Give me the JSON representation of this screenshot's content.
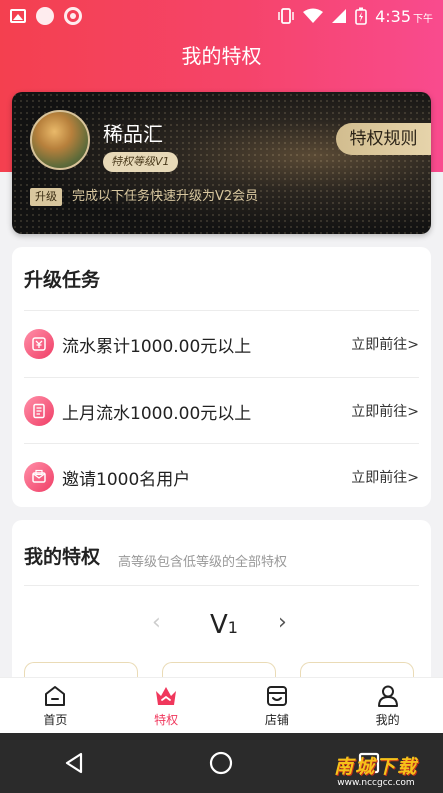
{
  "status_bar": {
    "time": "4:35",
    "ampm": "下午"
  },
  "header": {
    "title": "我的特权"
  },
  "vip_card": {
    "user_name": "稀品汇",
    "level_badge": "特权等级V1",
    "rules_button": "特权规则",
    "upgrade_tag": "升级",
    "upgrade_hint": "完成以下任务快速升级为V2会员"
  },
  "upgrade_tasks": {
    "title": "升级任务",
    "items": [
      {
        "label": "流水累计1000.00元以上",
        "action": "立即前往>",
        "icon": "money-icon"
      },
      {
        "label": "上月流水1000.00元以上",
        "action": "立即前往>",
        "icon": "receipt-icon"
      },
      {
        "label": "邀请1000名用户",
        "action": "立即前往>",
        "icon": "mail-icon"
      }
    ]
  },
  "privileges": {
    "title": "我的特权",
    "subtitle": "高等级包含低等级的全部特权",
    "current_level": "V",
    "current_level_num": "1",
    "prev_arrow": "‹",
    "next_arrow": "›"
  },
  "tab_bar": {
    "items": [
      {
        "label": "首页",
        "icon": "home-icon",
        "active": false
      },
      {
        "label": "特权",
        "icon": "crown-icon",
        "active": true
      },
      {
        "label": "店铺",
        "icon": "store-icon",
        "active": false
      },
      {
        "label": "我的",
        "icon": "user-icon",
        "active": false
      }
    ]
  },
  "watermark": {
    "main": "南城下载",
    "sub": "www.nccgcc.com"
  },
  "colors": {
    "accent": "#f0375c",
    "header_start": "#f4404f",
    "header_end": "#f94b8e",
    "gold": "#d2bd8f",
    "card_dark": "#121212"
  }
}
